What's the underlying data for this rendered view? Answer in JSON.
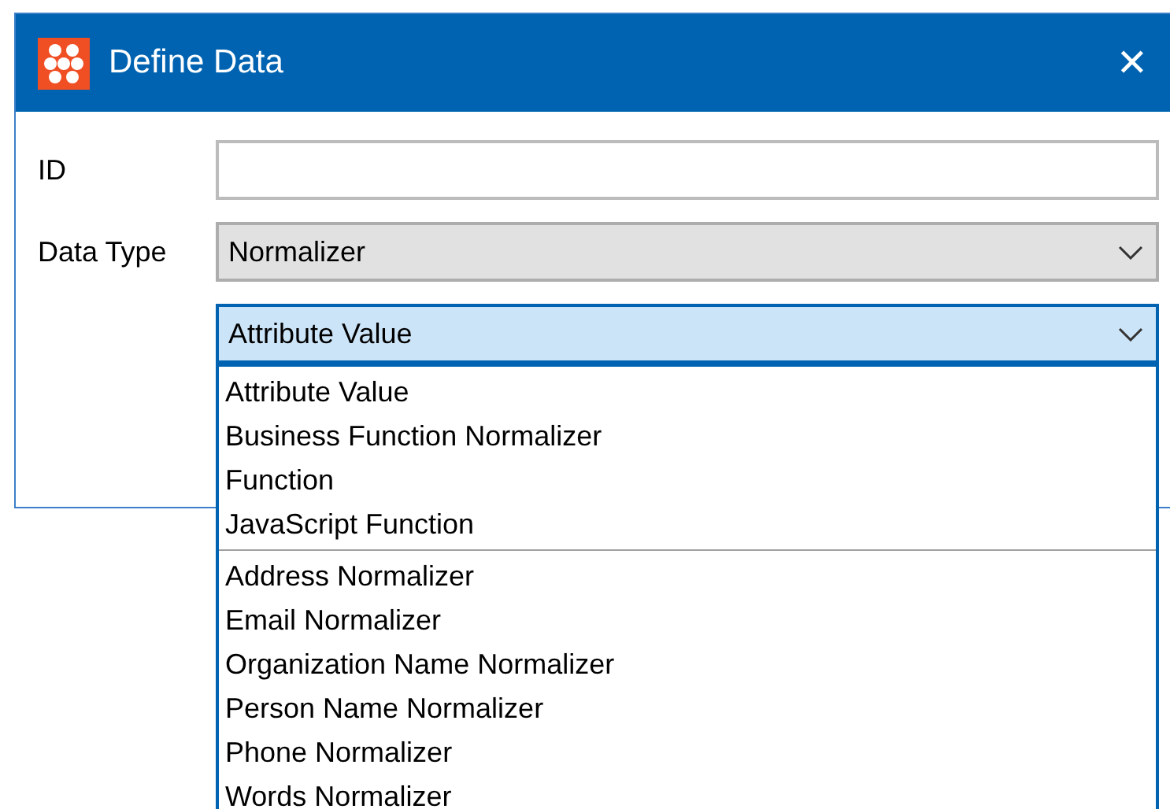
{
  "window": {
    "title": "Define Data",
    "close": "✕"
  },
  "fields": [
    {
      "kind": "text",
      "label": "ID"
    },
    {
      "kind": "combo",
      "label": "Data Type",
      "value": "Normalizer",
      "focused": false
    },
    {
      "kind": "combo",
      "value": "Attribute Value",
      "focused": true
    }
  ],
  "dropdown": {
    "groups": [
      [
        "Attribute Value",
        "Business Function Normalizer",
        "Function",
        "JavaScript Function"
      ],
      [
        "Address Normalizer",
        "Email Normalizer",
        "Organization Name Normalizer",
        "Person Name Normalizer",
        "Phone Normalizer",
        "Words Normalizer"
      ]
    ]
  }
}
